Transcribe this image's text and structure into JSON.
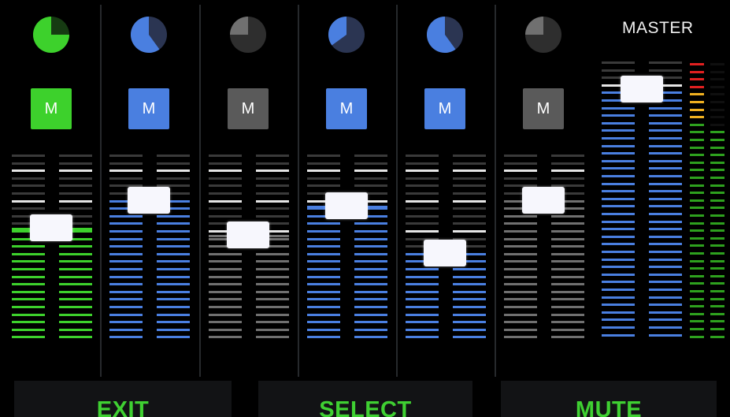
{
  "colors": {
    "background": "#0d0f11",
    "green": "#3dd12c",
    "blue": "#4a7fe0",
    "gray": "#707070",
    "inactive_tick": "#3a3a3a",
    "scale_white": "#e6e6e6",
    "softkey_text": "#3fd032"
  },
  "channels": [
    {
      "id": 1,
      "color": "green",
      "mute_label": "M",
      "muted": false,
      "knob_level": 0.75,
      "fader_level": 0.6
    },
    {
      "id": 2,
      "color": "blue",
      "mute_label": "M",
      "muted": false,
      "knob_level": 0.6,
      "fader_level": 0.75
    },
    {
      "id": 3,
      "color": "gray",
      "mute_label": "M",
      "muted": true,
      "knob_level": 0.25,
      "fader_level": 0.56
    },
    {
      "id": 4,
      "color": "blue",
      "mute_label": "M",
      "muted": false,
      "knob_level": 0.35,
      "fader_level": 0.72
    },
    {
      "id": 5,
      "color": "blue",
      "mute_label": "M",
      "muted": false,
      "knob_level": 0.6,
      "fader_level": 0.46
    },
    {
      "id": 6,
      "color": "gray",
      "mute_label": "M",
      "muted": true,
      "knob_level": 0.25,
      "fader_level": 0.75
    }
  ],
  "master": {
    "label": "MASTER",
    "color": "blue",
    "fader_level": 0.9,
    "meter_level": 0.7
  },
  "softkeys": [
    {
      "label": "EXIT"
    },
    {
      "label": "SELECT"
    },
    {
      "label": "MUTE"
    }
  ]
}
